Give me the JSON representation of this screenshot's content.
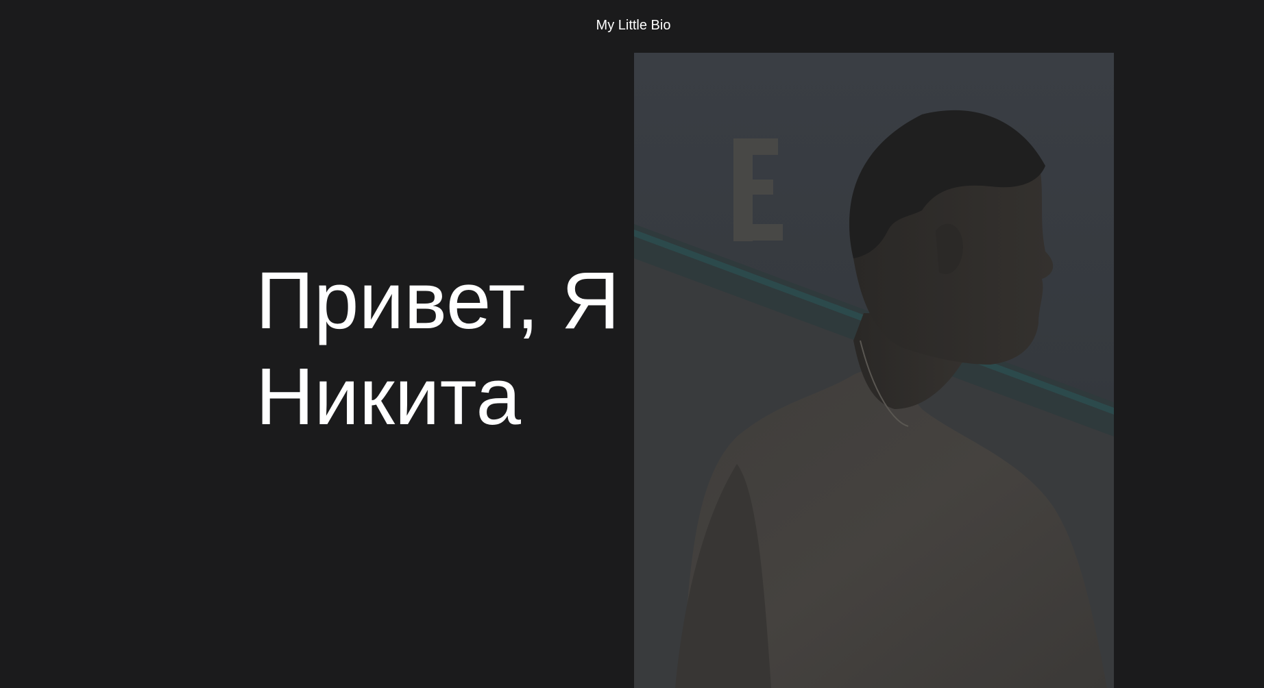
{
  "header": {
    "title": "My Little Bio"
  },
  "hero": {
    "line1": "Привет, Я",
    "line2": "Никита"
  },
  "photo": {
    "alt": "Portrait photo of Nikita"
  },
  "colors": {
    "background": "#1b1b1c",
    "text": "#ffffff"
  }
}
